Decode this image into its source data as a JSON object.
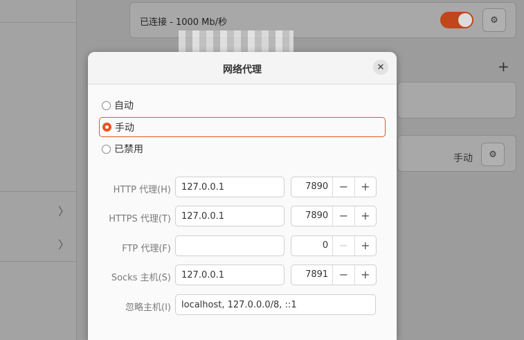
{
  "background": {
    "connection_label": "已连接 - 1000 Mb/秒",
    "proxy_mode_value": "手动",
    "add_label": "+"
  },
  "dialog": {
    "title": "网络代理",
    "close_label": "✕",
    "modes": [
      {
        "label": "自动",
        "selected": false
      },
      {
        "label": "手动",
        "selected": true
      },
      {
        "label": "已禁用",
        "selected": false
      }
    ],
    "fields": [
      {
        "label": "HTTP 代理(H)",
        "host": "127.0.0.1",
        "port": "7890"
      },
      {
        "label": "HTTPS 代理(T)",
        "host": "127.0.0.1",
        "port": "7890"
      },
      {
        "label": "FTP 代理(F)",
        "host": "",
        "port": "0"
      },
      {
        "label": "Socks 主机(S)",
        "host": "127.0.0.1",
        "port": "7891"
      }
    ],
    "ignore": {
      "label": "忽略主机(I)",
      "value": "localhost, 127.0.0.0/8, ::1"
    },
    "minus": "−",
    "plus": "+"
  },
  "colors": {
    "accent": "#e95420",
    "toggle": "#c0461b"
  },
  "icons": [
    "gear-icon",
    "close-icon",
    "chevron-right-icon",
    "plus-icon",
    "minus-icon"
  ]
}
